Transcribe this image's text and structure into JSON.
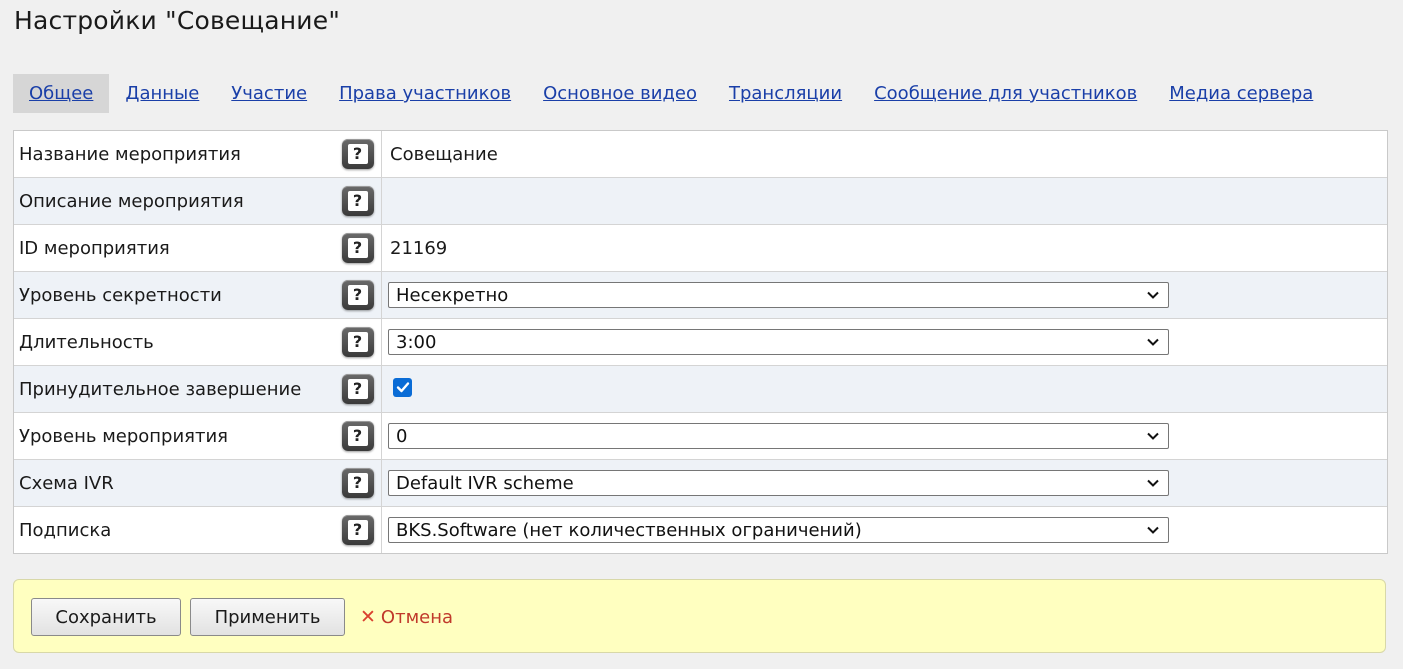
{
  "page_title": "Настройки \"Совещание\"",
  "tabs": [
    {
      "label": "Общее",
      "active": true
    },
    {
      "label": "Данные"
    },
    {
      "label": "Участие"
    },
    {
      "label": "Права участников"
    },
    {
      "label": "Основное видео"
    },
    {
      "label": "Трансляции"
    },
    {
      "label": "Сообщение для участников"
    },
    {
      "label": "Медиа сервера"
    }
  ],
  "fields": {
    "name": {
      "label": "Название мероприятия",
      "value": "Совещание"
    },
    "description": {
      "label": "Описание мероприятия",
      "value": ""
    },
    "id": {
      "label": "ID мероприятия",
      "value": "21169"
    },
    "secrecy": {
      "label": "Уровень секретности",
      "value": "Несекретно"
    },
    "duration": {
      "label": "Длительность",
      "value": "3:00"
    },
    "forced_end": {
      "label": "Принудительное завершение",
      "checked": true
    },
    "event_level": {
      "label": "Уровень мероприятия",
      "value": "0"
    },
    "ivr": {
      "label": "Схема IVR",
      "value": "Default IVR scheme"
    },
    "subscription": {
      "label": "Подписка",
      "value": "BKS.Software (нет количественных ограничений)"
    }
  },
  "help_glyph": "?",
  "actions": {
    "save_label": "Сохранить",
    "apply_label": "Применить",
    "cancel_label": "Отмена",
    "cancel_icon": "✕"
  },
  "colors": {
    "link": "#1a3fa8",
    "cancel": "#c0392b",
    "checkbox": "#0a6cd6",
    "action_bar_bg": "#ffffc0"
  }
}
